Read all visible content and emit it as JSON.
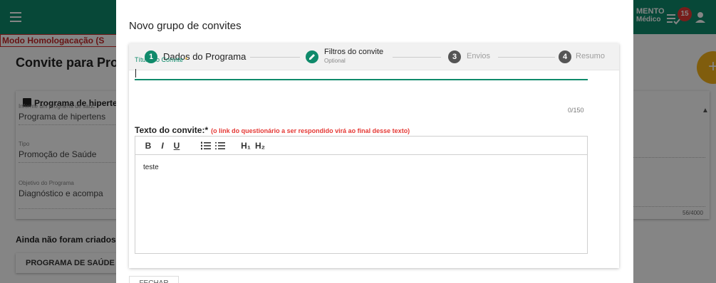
{
  "app": {
    "user_name": "MENTO",
    "user_role": "Médico",
    "notif_count": "15",
    "mode_text": "Modo Homologacação (S",
    "page_title": "Convite para Pro",
    "fab_label": "+"
  },
  "bg_card": {
    "heading": "Programa de hipertens",
    "program_label": "Informe um programa de saúc",
    "program_value": "Programa de hipertens",
    "type_label": "Tipo",
    "type_value": "Promoção de Saúde",
    "objective_label": "Objetivo do Programa",
    "objective_value": "Diagnóstico e acompa",
    "counter": "56/4000"
  },
  "bg_list": {
    "empty_text": "Ainda não foram criados",
    "program_button": "PROGRAMA DE SAÚDE",
    "close_button": "FECHAR"
  },
  "modal": {
    "title": "Novo grupo de convites",
    "steps": [
      {
        "number": "1",
        "label": "Dados do Programa",
        "state": "active"
      },
      {
        "number": "✎",
        "label": "Filtros do convite",
        "sublabel": "Optional",
        "state": "edit"
      },
      {
        "number": "3",
        "label": "Envios",
        "state": "inactive"
      },
      {
        "number": "4",
        "label": "Resumo",
        "state": "inactive"
      }
    ],
    "title_field_label": "Título do Convite",
    "title_field_required": "*",
    "title_field_value": "",
    "title_counter": "0/150",
    "text_label": "Texto do convite:*",
    "text_note": "(o link do questionário a ser respondido virá ao final desse texto)",
    "toolbar": {
      "bold": "B",
      "italic": "I",
      "underline": "U",
      "ordered_list": "⅓",
      "bullet_list": "☰",
      "h1": "H₁",
      "h2": "H₂"
    },
    "editor_text": "teste"
  },
  "colors": {
    "primary": "#0f8a6b",
    "step_active": "#0f8a6b",
    "step_inactive": "#9e9e9e",
    "fab": "#f6b21a",
    "badge": "#e53935"
  }
}
